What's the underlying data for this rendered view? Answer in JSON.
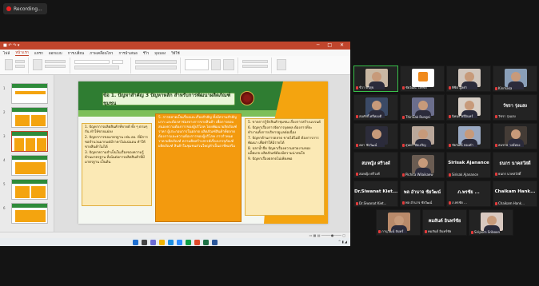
{
  "recording": {
    "label": "Recording..."
  },
  "powerpoint": {
    "tabs": [
      "ไฟล์",
      "หน้าแรก",
      "แทรก",
      "ออกแบบ",
      "การเปลี่ยน",
      "ภาพเคลื่อนไหว",
      "การนำเสนอ",
      "รีวิว",
      "มุมมอง",
      "วิธีใช้"
    ],
    "slide": {
      "title": "ข้อ 1. ปัญหาสำคัญ 3 ปัญหาหลัก สำหรับการพัฒนาผลิตภัณฑ์ชุมชน",
      "col1": [
        "1. ปัญหาการผลิตสินค้าที่ขายดี ทั้ง ๆ ตามๆ กัน ทำให้ขายแย่ลง",
        "2. ปัญหาการขอมาตรฐาน เช่น อย. ที่มีการขอจำนวนมากแต่มีราคาไม่แน่นอน ทำให้ขายสินค้าไม่ได้",
        "3. ปัญหาความจำเป็นในเรื่องของความรู้ด้านมาตรฐาน ที่เน้นต่อการผลิตสินค้าที่มีมาตรฐาน เป็นต้น"
      ],
      "col2": [
        "5. การตลาดเป็นเรื่องและเรื่องสำคัญ ทั้งมีความสำคัญมาก และต้องหาช่องทางการขายสินค้า เพื่อการตอบสนองความต้องการของผู้บริโภค โดยพัฒนาผลิตภัณฑ์ ราคา ผู้ประกอบการในตลาด ผลิตภัณฑ์สินค้าที่ตลาดต้องการและความต้องการของผู้บริโภค การกำหนดราคาผลิตภัณฑ์ ความคิดสร้างสรรค์เรื่องบรรจุภัณฑ์ ผลิตภัณฑ์ สินค้าในชุมชนส่วนใหญ่ทำเป็นอาชีพเสริม"
      ],
      "col3": [
        "5. ขาดการรู้จักสินค้าชุมชน เรื่องการสร้างแบรนด์",
        "6. ปัญหาเรื่องการจัดการบุคคล ต้องการที่จะทำงานทั้งการบริหารดูแลต่อเนื่อง",
        "7. ปัญหาด้านการตลาด ขายได้ไม่ดี ต้องการการพัฒนา เพื่อทำให้มีรายได้",
        "8. ปลาน้ำจืด ปัญหาเรื่องความสวยงามของแพ็คเกจ ผลิตภัณฑ์ต้องมีความน่าสนใจ",
        "9. ปัญหาเรื่องตลาดไม่เพียงพอ"
      ]
    }
  },
  "participants": [
    {
      "name": "ชีวา  ศรีสุข",
      "variant": "video",
      "color": "#c9b8a3",
      "active": true
    },
    {
      "name": "ชัยวัฒน์ วงศ์ชัย",
      "variant": "logo",
      "color": "#f08a1c"
    },
    {
      "name": "พิชิต  มูลคำ",
      "variant": "video",
      "color": "#d1c6bd"
    },
    {
      "name": "Kinmaka",
      "variant": "video",
      "color": "#8a9fb8"
    },
    {
      "name": "สมศักดิ์ ศรีทองดี",
      "variant": "video",
      "color": "#3b4a66"
    },
    {
      "name": "ThiriSak Rungsi",
      "variant": "video",
      "color": "#6b6e8c"
    },
    {
      "name": "นิพนธ์ ศรีอินทร์",
      "variant": "video",
      "color": "#d8cfc6"
    },
    {
      "name": "วัชรา รุ่งแสง",
      "variant": "text"
    },
    {
      "name": "ลดา ชัยวัฒน์",
      "variant": "video",
      "color": "#2c2c3a"
    },
    {
      "name": "สุนทร ชัยเจริญ",
      "variant": "video",
      "color": "#b9a79a"
    },
    {
      "name": "ชัยวัฒน์ ทองคำ",
      "variant": "video",
      "color": "#9aa9c2"
    },
    {
      "name": "สมชาย  วงษ์ทอง",
      "variant": "video",
      "color": "#443c36"
    },
    {
      "name": "สมหญิง ศรีวงศ์",
      "variant": "text"
    },
    {
      "name": "Pichita Wilaikaew",
      "variant": "video",
      "color": "#6a5c52"
    },
    {
      "name": "Sirisak Ajanance",
      "variant": "text"
    },
    {
      "name": "ธนกร นาคสวัสดิ์",
      "variant": "text"
    },
    {
      "name": "Dr.Siwanat Kiet...",
      "variant": "text"
    },
    {
      "name": "พล อำนาจ ชัยวัฒน์",
      "variant": "text"
    },
    {
      "name": "ภ.พรชัย ...",
      "variant": "text"
    },
    {
      "name": "Chaikam Hank...",
      "variant": "text"
    },
    {
      "name": "ภานุวัฒน์ จันทร์",
      "variant": "video",
      "color": "#b98a6a"
    },
    {
      "name": "คมสันต์ อินทร์ชัย",
      "variant": "text"
    },
    {
      "name": "Siriporn Sriboon",
      "variant": "video",
      "color": "#d8c8c0"
    }
  ]
}
